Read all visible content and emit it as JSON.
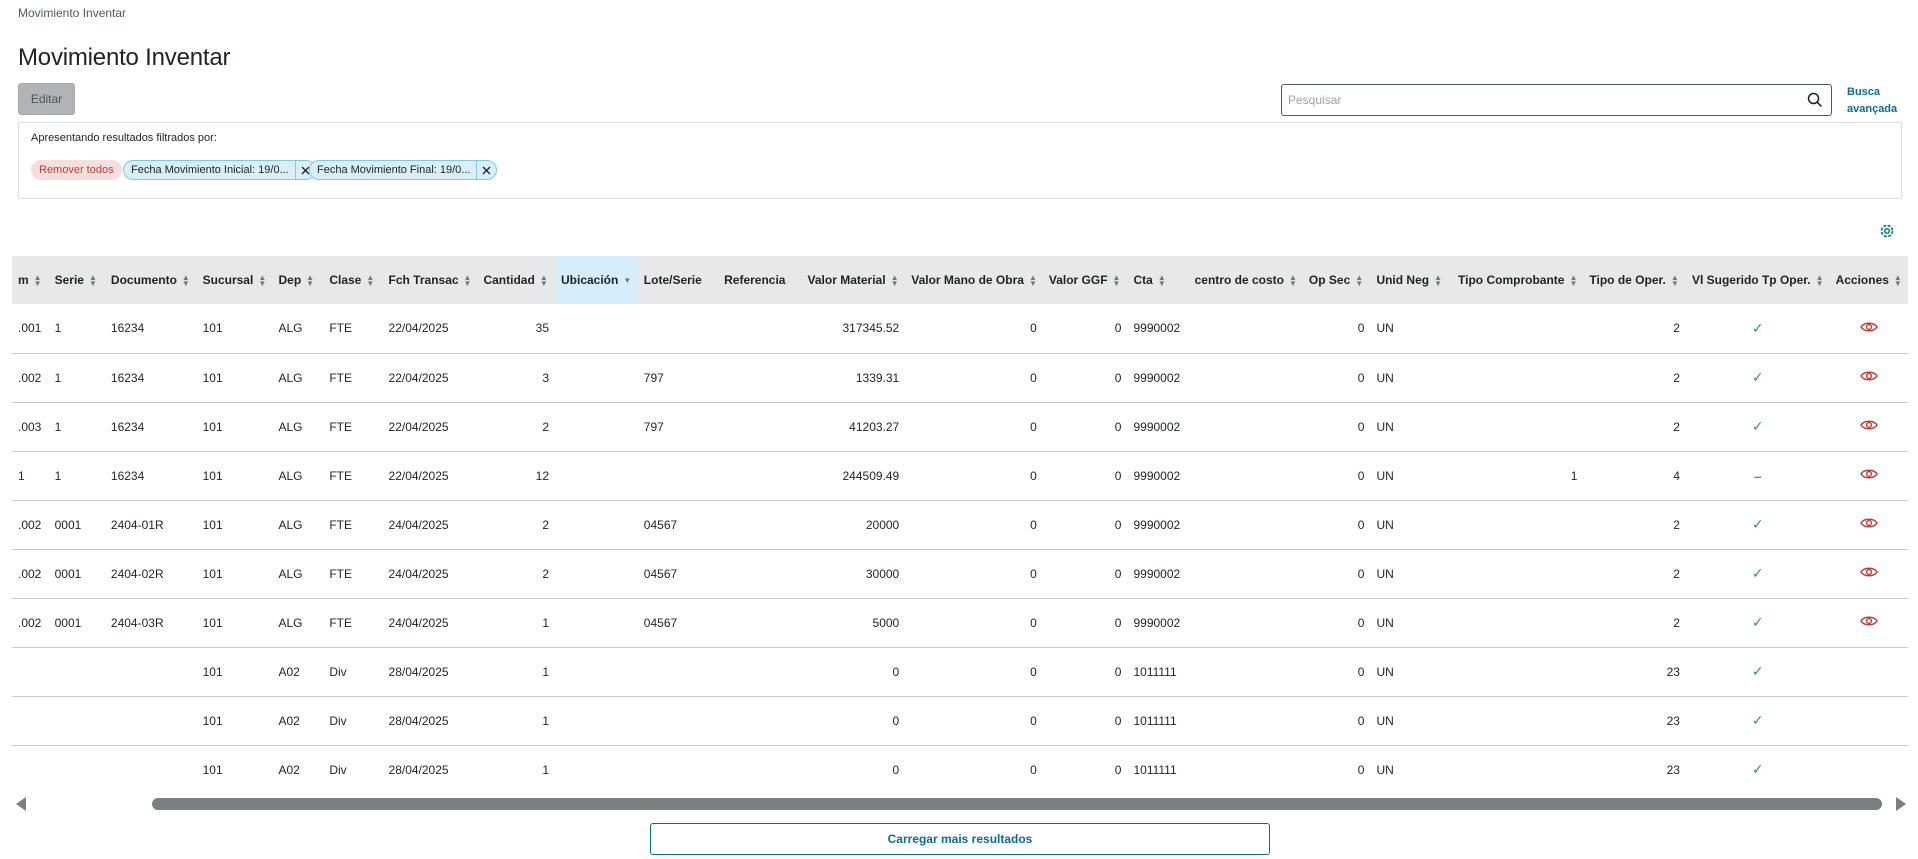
{
  "breadcrumb": "Movimiento Inventar",
  "title": "Movimiento Inventar",
  "toolbar": {
    "edit_label": "Editar"
  },
  "search": {
    "placeholder": "Pesquisar",
    "value": "",
    "advanced_label": "Busca avançada"
  },
  "filters": {
    "title": "Apresentando resultados filtrados por:",
    "remove_all_label": "Remover todos",
    "chips": [
      "Fecha Movimiento Inicial: 19/0...",
      "Fecha Movimiento Final: 19/0..."
    ]
  },
  "table": {
    "columns": [
      "m",
      "Serie",
      "Documento",
      "Sucursal",
      "Dep",
      "Clase",
      "Fch Transac",
      "Cantidad",
      "Ubicación",
      "Lote/Serie",
      "Referencia",
      "Valor Material",
      "Valor Mano de Obra",
      "Valor GGF",
      "Cta",
      "centro de costo",
      "Op Sec",
      "Unid Neg",
      "Tipo Comprobante",
      "Tipo de Oper.",
      "Vl Sugerido Tp Oper.",
      "Acciones"
    ],
    "rows": [
      {
        "c0": ".001",
        "serie": "1",
        "documento": "16234",
        "sucursal": "101",
        "dep": "ALG",
        "clase": "FTE",
        "fecha": "22/04/2025",
        "cantidad": "35",
        "ubicacion": "",
        "lote": "",
        "referencia": "",
        "valor_material": "317345.52",
        "valor_mano": "0",
        "valor_ggf": "0",
        "cta": "9990002",
        "centro": "",
        "op_sec": "0",
        "unid_neg": "UN",
        "tipo_comp": "",
        "tipo_oper": "2",
        "vl_sug": "check",
        "accion": "view"
      },
      {
        "c0": ".002",
        "serie": "1",
        "documento": "16234",
        "sucursal": "101",
        "dep": "ALG",
        "clase": "FTE",
        "fecha": "22/04/2025",
        "cantidad": "3",
        "ubicacion": "",
        "lote": "797",
        "referencia": "",
        "valor_material": "1339.31",
        "valor_mano": "0",
        "valor_ggf": "0",
        "cta": "9990002",
        "centro": "",
        "op_sec": "0",
        "unid_neg": "UN",
        "tipo_comp": "",
        "tipo_oper": "2",
        "vl_sug": "check",
        "accion": "view"
      },
      {
        "c0": ".003",
        "serie": "1",
        "documento": "16234",
        "sucursal": "101",
        "dep": "ALG",
        "clase": "FTE",
        "fecha": "22/04/2025",
        "cantidad": "2",
        "ubicacion": "",
        "lote": "797",
        "referencia": "",
        "valor_material": "41203.27",
        "valor_mano": "0",
        "valor_ggf": "0",
        "cta": "9990002",
        "centro": "",
        "op_sec": "0",
        "unid_neg": "UN",
        "tipo_comp": "",
        "tipo_oper": "2",
        "vl_sug": "check",
        "accion": "view"
      },
      {
        "c0": "1",
        "serie": "1",
        "documento": "16234",
        "sucursal": "101",
        "dep": "ALG",
        "clase": "FTE",
        "fecha": "22/04/2025",
        "cantidad": "12",
        "ubicacion": "",
        "lote": "",
        "referencia": "",
        "valor_material": "244509.49",
        "valor_mano": "0",
        "valor_ggf": "0",
        "cta": "9990002",
        "centro": "",
        "op_sec": "0",
        "unid_neg": "UN",
        "tipo_comp": "1",
        "tipo_oper": "4",
        "vl_sug": "dash",
        "accion": "view"
      },
      {
        "c0": ".002",
        "serie": "0001",
        "documento": "2404-01R",
        "sucursal": "101",
        "dep": "ALG",
        "clase": "FTE",
        "fecha": "24/04/2025",
        "cantidad": "2",
        "ubicacion": "",
        "lote": "04567",
        "referencia": "",
        "valor_material": "20000",
        "valor_mano": "0",
        "valor_ggf": "0",
        "cta": "9990002",
        "centro": "",
        "op_sec": "0",
        "unid_neg": "UN",
        "tipo_comp": "",
        "tipo_oper": "2",
        "vl_sug": "check",
        "accion": "view"
      },
      {
        "c0": ".002",
        "serie": "0001",
        "documento": "2404-02R",
        "sucursal": "101",
        "dep": "ALG",
        "clase": "FTE",
        "fecha": "24/04/2025",
        "cantidad": "2",
        "ubicacion": "",
        "lote": "04567",
        "referencia": "",
        "valor_material": "30000",
        "valor_mano": "0",
        "valor_ggf": "0",
        "cta": "9990002",
        "centro": "",
        "op_sec": "0",
        "unid_neg": "UN",
        "tipo_comp": "",
        "tipo_oper": "2",
        "vl_sug": "check",
        "accion": "view"
      },
      {
        "c0": ".002",
        "serie": "0001",
        "documento": "2404-03R",
        "sucursal": "101",
        "dep": "ALG",
        "clase": "FTE",
        "fecha": "24/04/2025",
        "cantidad": "1",
        "ubicacion": "",
        "lote": "04567",
        "referencia": "",
        "valor_material": "5000",
        "valor_mano": "0",
        "valor_ggf": "0",
        "cta": "9990002",
        "centro": "",
        "op_sec": "0",
        "unid_neg": "UN",
        "tipo_comp": "",
        "tipo_oper": "2",
        "vl_sug": "check",
        "accion": "view"
      },
      {
        "c0": "",
        "serie": "",
        "documento": "",
        "sucursal": "101",
        "dep": "A02",
        "clase": "Div",
        "fecha": "28/04/2025",
        "cantidad": "1",
        "ubicacion": "",
        "lote": "",
        "referencia": "",
        "valor_material": "0",
        "valor_mano": "0",
        "valor_ggf": "0",
        "cta": "1011111",
        "centro": "",
        "op_sec": "0",
        "unid_neg": "UN",
        "tipo_comp": "",
        "tipo_oper": "23",
        "vl_sug": "check",
        "accion": ""
      },
      {
        "c0": "",
        "serie": "",
        "documento": "",
        "sucursal": "101",
        "dep": "A02",
        "clase": "Div",
        "fecha": "28/04/2025",
        "cantidad": "1",
        "ubicacion": "",
        "lote": "",
        "referencia": "",
        "valor_material": "0",
        "valor_mano": "0",
        "valor_ggf": "0",
        "cta": "1011111",
        "centro": "",
        "op_sec": "0",
        "unid_neg": "UN",
        "tipo_comp": "",
        "tipo_oper": "23",
        "vl_sug": "check",
        "accion": ""
      },
      {
        "c0": "",
        "serie": "",
        "documento": "",
        "sucursal": "101",
        "dep": "A02",
        "clase": "Div",
        "fecha": "28/04/2025",
        "cantidad": "1",
        "ubicacion": "",
        "lote": "",
        "referencia": "",
        "valor_material": "0",
        "valor_mano": "0",
        "valor_ggf": "0",
        "cta": "1011111",
        "centro": "",
        "op_sec": "0",
        "unid_neg": "UN",
        "tipo_comp": "",
        "tipo_oper": "23",
        "vl_sug": "check",
        "accion": ""
      }
    ]
  },
  "load_more_label": "Carregar mais resultados",
  "colors": {
    "accent": "#0c6c94",
    "danger": "#be3e37",
    "success": "#2b9b5a",
    "warning": "#d26a2c",
    "header_bg": "#e6e8e9"
  }
}
